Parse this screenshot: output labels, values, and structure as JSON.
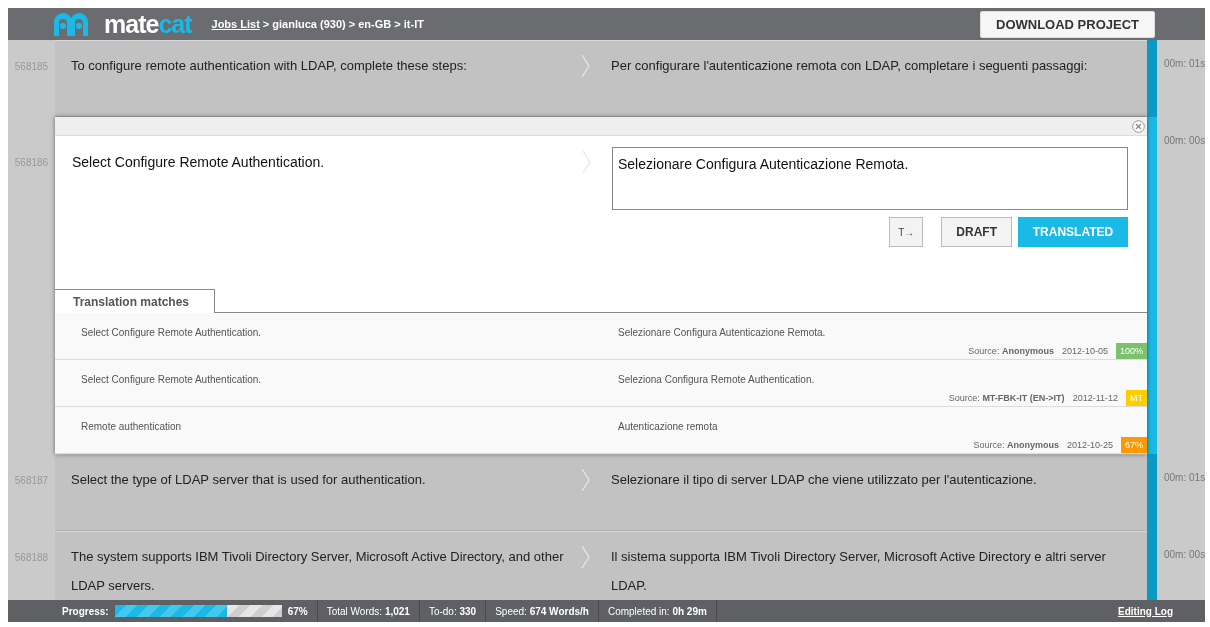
{
  "header": {
    "logo": {
      "part_1": "mate",
      "part_2": "cat"
    },
    "breadcrumb": {
      "link": "Jobs List",
      "path": " > gianluca (930) > en-GB > it-IT"
    },
    "download_button": "DOWNLOAD PROJECT"
  },
  "segments": [
    {
      "kind": "collapsed",
      "id": "568185",
      "source": "To configure remote authentication with LDAP, complete these steps:",
      "target": "Per configurare l'autenticazione remota con LDAP, completare i seguenti passaggi:",
      "time": "00m: 01s",
      "color": "#0a9bc4"
    },
    {
      "kind": "open",
      "id": "568186",
      "source": "Select Configure Remote Authentication.",
      "target": "Selezionare Configura Autenticazione Remota.",
      "time": "00m: 00s",
      "color": "#1ab9e6",
      "tag_button": "T→",
      "draft_button": "DRAFT",
      "translated_button": "TRANSLATED",
      "matches_tab": "Translation matches",
      "matches": [
        {
          "source": "Select Configure Remote Authentication.",
          "target": "Selezionare Configura Autenticazione Remota.",
          "source_label": "Source:",
          "origin": "Anonymous",
          "date": "2012-10-05",
          "score": "100%",
          "color": "#7ac36a"
        },
        {
          "source": "Select Configure Remote Authentication.",
          "target": "Seleziona Configura Remote Authentication.",
          "source_label": "Source:",
          "origin": "MT-FBK-IT (EN->IT)",
          "date": "2012-11-12",
          "score": "MT",
          "color": "#ffcc00"
        },
        {
          "source": "Remote authentication",
          "target": "Autenticazione remota",
          "source_label": "Source:",
          "origin": "Anonymous",
          "date": "2012-10-25",
          "score": "67%",
          "color": "#ff9900"
        }
      ]
    },
    {
      "kind": "collapsed",
      "id": "568187",
      "source": "Select the type of LDAP server that is used for authentication.",
      "target": "Selezionare il tipo di server LDAP che viene utilizzato per l'autenticazione.",
      "time": "00m: 01s",
      "color": "#0a9bc4"
    },
    {
      "kind": "collapsed",
      "id": "568188",
      "source": "The system supports IBM Tivoli Directory Server, Microsoft Active Directory, and other LDAP servers.",
      "target": "Il sistema supporta IBM Tivoli Directory Server, Microsoft Active Directory e altri server LDAP.",
      "time": "00m: 00s",
      "color": "#0a9bc4"
    }
  ],
  "footer": {
    "progress_label": "Progress:",
    "level": 0.67,
    "progress_value": "67%",
    "stats": [
      "Total Words: **1,021**",
      "To-do: **330**",
      "Speed: **674 Words/h**",
      "Completed in: **0h 29m**"
    ],
    "editing_log": "Editing Log"
  }
}
